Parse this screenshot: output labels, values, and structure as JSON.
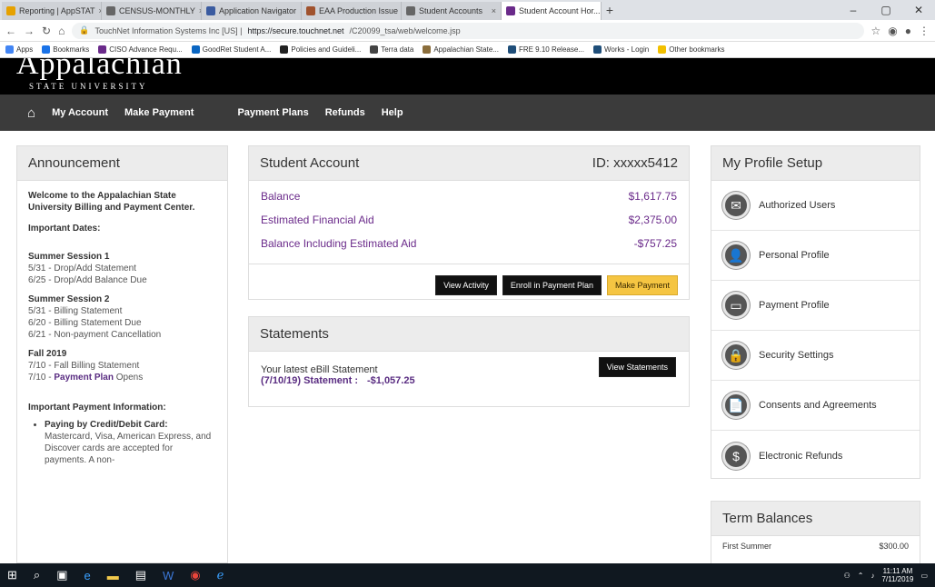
{
  "browser": {
    "tabs": [
      {
        "label": "Reporting | AppSTAT",
        "color": "#e6a100",
        "active": false
      },
      {
        "label": "CENSUS-MONTHLY",
        "color": "#666666",
        "active": false
      },
      {
        "label": "Application Navigator",
        "color": "#3a5ba0",
        "active": false
      },
      {
        "label": "EAA Production Issue",
        "color": "#a0522d",
        "active": false
      },
      {
        "label": "Student Accounts",
        "color": "#666666",
        "active": false
      },
      {
        "label": "Student Account Hor...",
        "color": "#6a2a8a",
        "active": true
      }
    ],
    "new_tab": "+",
    "window_controls": [
      "–",
      "▢",
      "✕"
    ],
    "url_prefix": "TouchNet Information Systems Inc [US] |",
    "url_host": "https://secure.touchnet.net",
    "url_path": "/C20099_tsa/web/welcome.jsp",
    "bookmarks": [
      {
        "label": "Apps",
        "color": "#4285f4"
      },
      {
        "label": "Bookmarks",
        "color": "#1a73e8"
      },
      {
        "label": "CISO Advance Requ...",
        "color": "#6a2a8a"
      },
      {
        "label": "GoodRet Student A...",
        "color": "#0a66c2"
      },
      {
        "label": "Policies and Guideli...",
        "color": "#222222"
      },
      {
        "label": "Terra data",
        "color": "#444444"
      },
      {
        "label": "Appalachian State...",
        "color": "#8a6d3b"
      },
      {
        "label": "FRE 9.10 Release...",
        "color": "#1f4e79"
      },
      {
        "label": "Works - Login",
        "color": "#1f4e79"
      },
      {
        "label": "Other bookmarks",
        "color": "#f2c000"
      }
    ]
  },
  "site": {
    "logo_name": "Appalachian",
    "logo_sub": "STATE UNIVERSITY",
    "nav": [
      "My Account",
      "Make Payment",
      "Payment Plans",
      "Refunds",
      "Help"
    ]
  },
  "announcement": {
    "title": "Announcement",
    "welcome": "Welcome to the Appalachian State University Billing and Payment Center.",
    "important_dates": "Important Dates:",
    "sessions": [
      {
        "name": "Summer Session 1",
        "lines": [
          "5/31 - Drop/Add Statement",
          "6/25 - Drop/Add Balance Due"
        ]
      },
      {
        "name": "Summer Session 2",
        "lines": [
          "5/31 - Billing Statement",
          "6/20 - Billing Statement Due",
          "6/21 - Non-payment Cancellation"
        ]
      },
      {
        "name": "Fall 2019",
        "lines": [
          "7/10 - Fall Billing Statement"
        ],
        "extra_prefix": "7/10 - ",
        "extra_link": "Payment Plan",
        "extra_suffix": " Opens"
      }
    ],
    "payment_info": "Important Payment Information:",
    "bullet_head": "Paying by Credit/Debit Card:",
    "bullet_text": "Mastercard, Visa, American Express, and Discover cards are accepted for payments. A non-"
  },
  "account": {
    "title": "Student Account",
    "id": "ID: xxxxx5412",
    "rows": [
      {
        "label": "Balance",
        "value": "$1,617.75"
      },
      {
        "label": "Estimated Financial Aid",
        "value": "$2,375.00"
      },
      {
        "label": "Balance Including Estimated Aid",
        "value": "-$757.25"
      }
    ],
    "buttons": {
      "activity": "View Activity",
      "enroll": "Enroll in Payment Plan",
      "pay": "Make Payment"
    }
  },
  "statements": {
    "title": "Statements",
    "latest": "Your latest eBill Statement",
    "date_label": "(7/10/19) Statement :",
    "amount": "-$1,057.25",
    "button": "View Statements"
  },
  "profile": {
    "title": "My Profile Setup",
    "items": [
      {
        "label": "Authorized Users",
        "icon": "✉"
      },
      {
        "label": "Personal Profile",
        "icon": "👤"
      },
      {
        "label": "Payment Profile",
        "icon": "▭"
      },
      {
        "label": "Security Settings",
        "icon": "🔒"
      },
      {
        "label": "Consents and Agreements",
        "icon": "📄"
      },
      {
        "label": "Electronic Refunds",
        "icon": "$"
      }
    ]
  },
  "term": {
    "title": "Term Balances",
    "rows": [
      {
        "label": "First Summer",
        "value": "$300.00"
      }
    ]
  },
  "taskbar": {
    "time": "11:11 AM",
    "date": "7/11/2019"
  },
  "colors": {
    "purple": "#6a2a8a",
    "gold": "#f5c542",
    "nav_bg": "#3b3b3b"
  }
}
